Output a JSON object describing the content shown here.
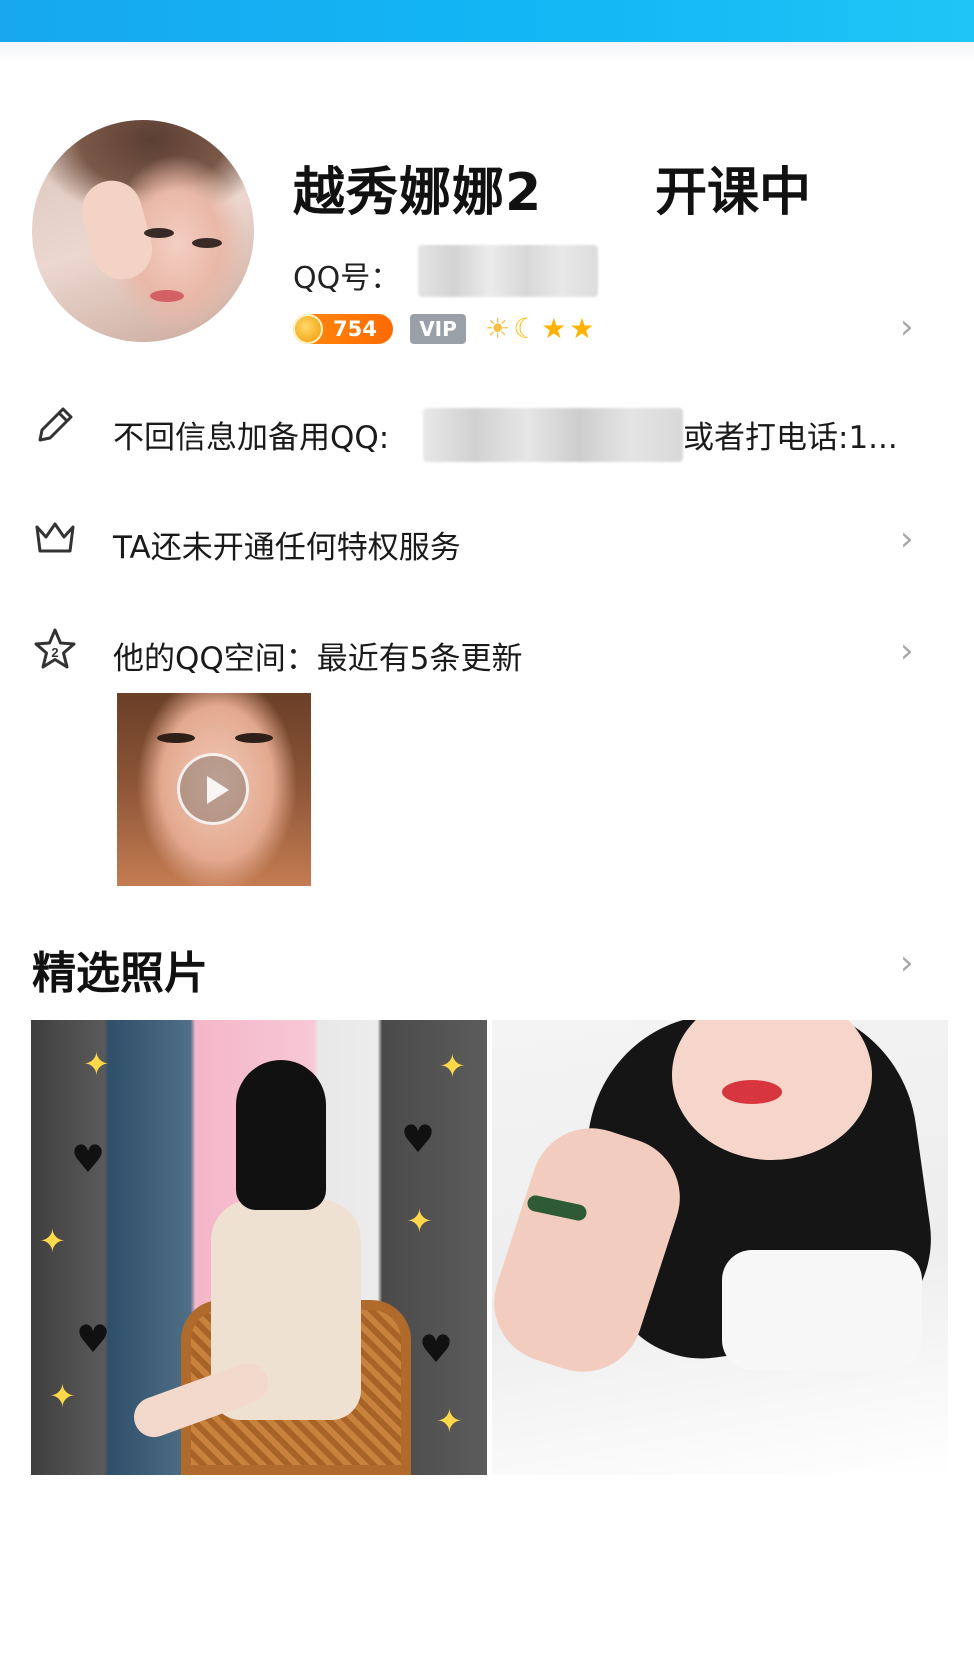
{
  "profile": {
    "name": "越秀娜娜2",
    "status": "开课中",
    "qq_label": "QQ号：",
    "coin_count": "754",
    "vip_label": "VIP"
  },
  "rows": {
    "signature_prefix": "不回信息加备用QQ:",
    "signature_suffix": "或者打电话:1...",
    "privilege": "TA还未开通任何特权服务",
    "qzone": "他的QQ空间：最近有5条更新"
  },
  "featured": {
    "title": "精选照片"
  },
  "icons": {
    "edit": "pencil-icon",
    "privilege": "crown-icon",
    "qzone": "star-icon",
    "chevron": "chevron-right-icon",
    "play": "play-icon"
  },
  "colors": {
    "topbar": "#17a8f0",
    "coin_badge": "#ff7a00",
    "vip_badge": "#9aa0a8",
    "chevron": "#a8a8a8"
  }
}
